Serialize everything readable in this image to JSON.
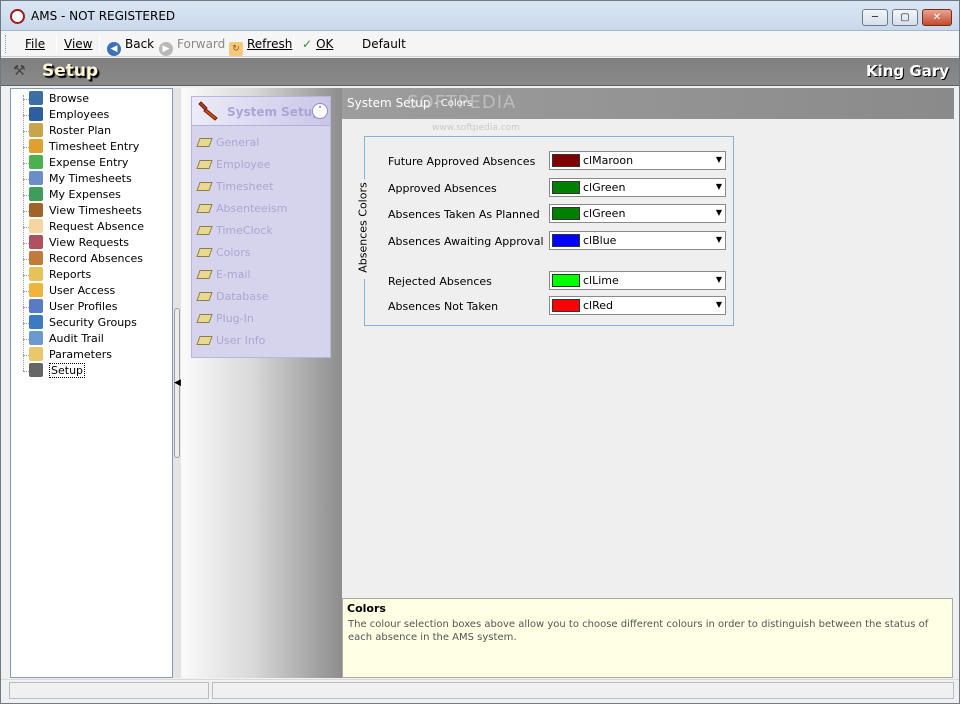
{
  "window": {
    "title": "AMS - NOT REGISTERED"
  },
  "menu": {
    "file": "File",
    "view": "View",
    "back": "Back",
    "forward": "Forward",
    "refresh": "Refresh",
    "ok": "OK",
    "default": "Default"
  },
  "banner": {
    "title": "Setup",
    "user": "King Gary"
  },
  "tree": {
    "items": [
      {
        "label": "Browse",
        "icon": "browse-icon"
      },
      {
        "label": "Employees",
        "icon": "employees-icon"
      },
      {
        "label": "Roster Plan",
        "icon": "roster-plan-icon"
      },
      {
        "label": "Timesheet Entry",
        "icon": "timesheet-entry-icon"
      },
      {
        "label": "Expense Entry",
        "icon": "expense-entry-icon"
      },
      {
        "label": "My Timesheets",
        "icon": "my-timesheets-icon"
      },
      {
        "label": "My Expenses",
        "icon": "my-expenses-icon"
      },
      {
        "label": "View Timesheets",
        "icon": "view-timesheets-icon"
      },
      {
        "label": "Request Absence",
        "icon": "hand-icon"
      },
      {
        "label": "View Requests",
        "icon": "eye-icon"
      },
      {
        "label": "Record Absences",
        "icon": "pencil-icon"
      },
      {
        "label": "Reports",
        "icon": "reports-icon"
      },
      {
        "label": "User Access",
        "icon": "user-access-icon"
      },
      {
        "label": "User Profiles",
        "icon": "user-profiles-icon"
      },
      {
        "label": "Security Groups",
        "icon": "security-groups-icon"
      },
      {
        "label": "Audit Trail",
        "icon": "audit-trail-icon"
      },
      {
        "label": "Parameters",
        "icon": "folder-icon"
      },
      {
        "label": "Setup",
        "icon": "tools-icon"
      }
    ]
  },
  "nav": {
    "title": "System Setup",
    "items": [
      "General",
      "Employee",
      "Timesheet",
      "Absenteeism",
      "TimeClock",
      "Colors",
      "E-mail",
      "Database",
      "Plug-In",
      "User Info"
    ]
  },
  "content": {
    "title": "System Setup",
    "subtitle": "- Colors",
    "watermark": "SOFTPEDIA",
    "watermark_url": "www.softpedia.com",
    "group_caption": "Absences Colors",
    "rows": [
      {
        "label": "Future Approved Absences",
        "value": "clMaroon",
        "color": "#800000"
      },
      {
        "label": "Approved Absences",
        "value": "clGreen",
        "color": "#008000"
      },
      {
        "label": "Absences Taken As Planned",
        "value": "clGreen",
        "color": "#008000"
      },
      {
        "label": "Absences Awaiting Approval",
        "value": "clBlue",
        "color": "#0000ff"
      },
      {
        "label": "Rejected Absences",
        "value": "clLime",
        "color": "#00ff00"
      },
      {
        "label": "Absences Not Taken",
        "value": "clRed",
        "color": "#ff0000"
      }
    ]
  },
  "info": {
    "title": "Colors",
    "text": "The colour selection boxes above allow you to choose different colours in order to distinguish between the status of each absence in the AMS system."
  }
}
